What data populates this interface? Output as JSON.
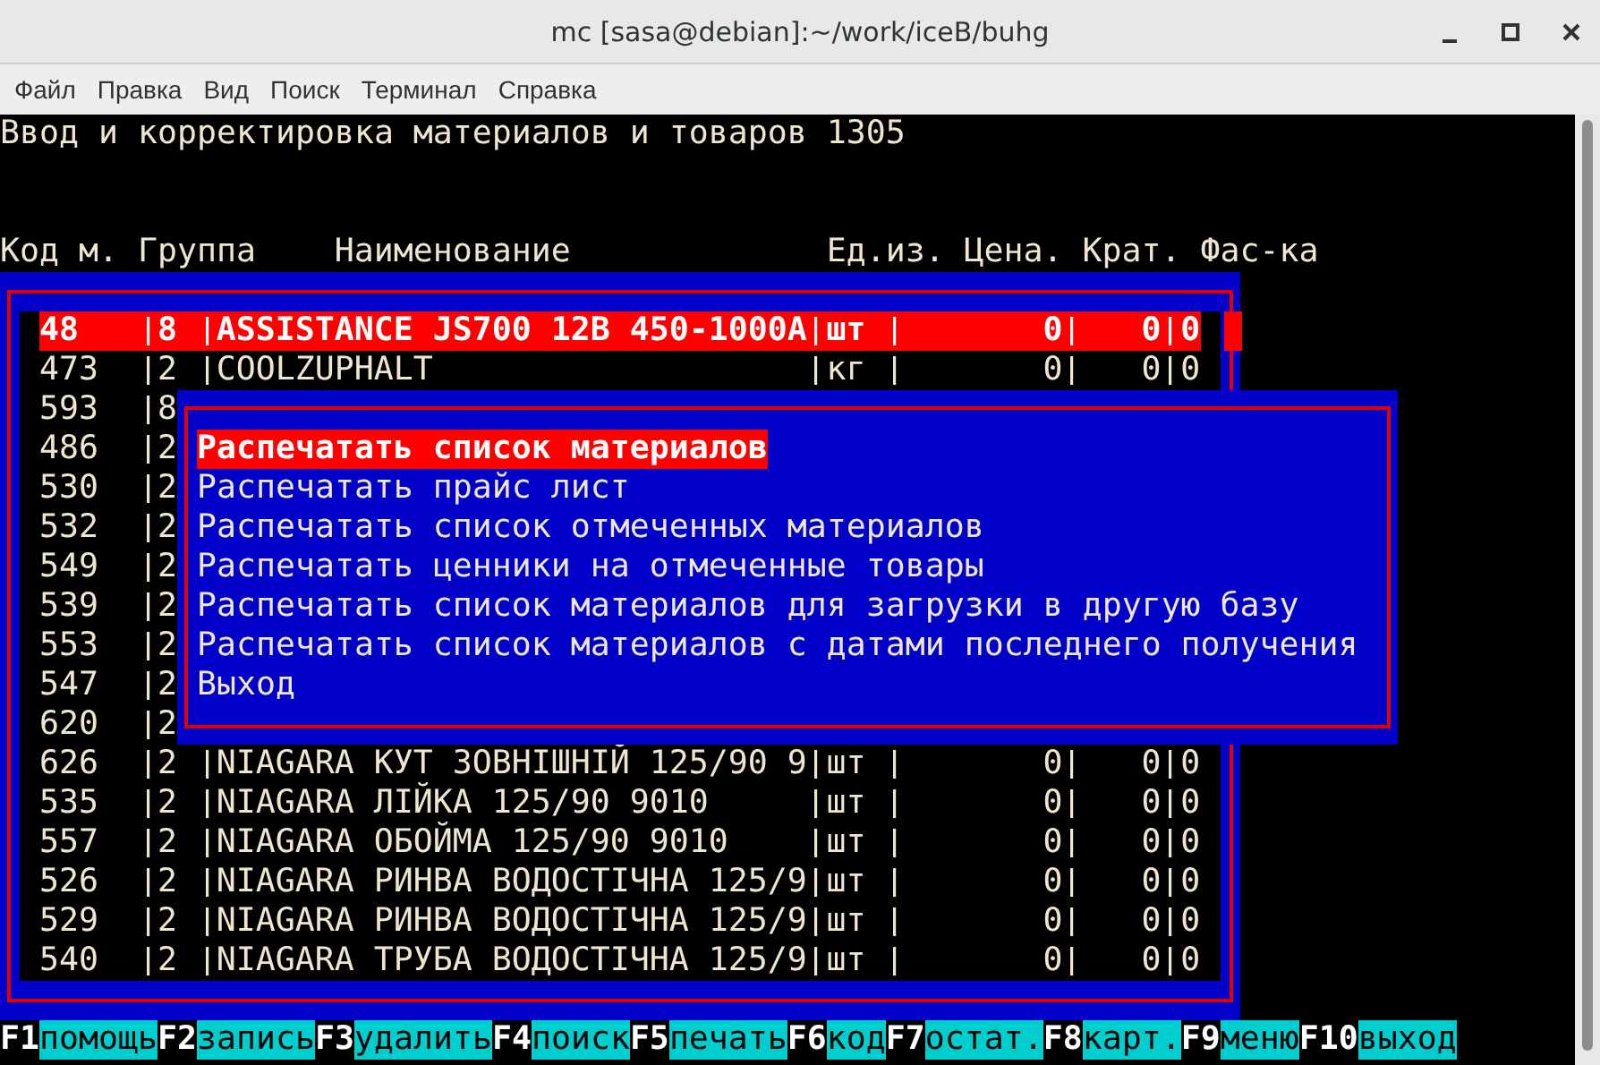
{
  "window": {
    "title": "mc [sasa@debian]:~/work/iceB/buhg"
  },
  "menu": [
    "Файл",
    "Правка",
    "Вид",
    "Поиск",
    "Терминал",
    "Справка"
  ],
  "screen_title": "Ввод и корректировка материалов и товаров 1305",
  "table": {
    "columns": [
      "Код м.",
      "Группа",
      "Наименование",
      "Ед.из.",
      "Цена.",
      "Крат.",
      "Фас-ка"
    ],
    "rows": [
      {
        "code": "48",
        "group": "8",
        "name": "ASSISTANCE JS700 12B 450-1000A",
        "unit": "шт",
        "price": "0",
        "multiplicity": "0",
        "packing": "0",
        "selected": true
      },
      {
        "code": "473",
        "group": "2",
        "name": "COOLZUPHALT",
        "unit": "кг",
        "price": "0",
        "multiplicity": "0",
        "packing": "0",
        "selected": false
      },
      {
        "code": "593",
        "group": "8",
        "selected": false
      },
      {
        "code": "486",
        "group": "2",
        "selected": false
      },
      {
        "code": "530",
        "group": "2",
        "selected": false
      },
      {
        "code": "532",
        "group": "2",
        "selected": false
      },
      {
        "code": "549",
        "group": "2",
        "selected": false
      },
      {
        "code": "539",
        "group": "2",
        "selected": false
      },
      {
        "code": "553",
        "group": "2",
        "selected": false
      },
      {
        "code": "547",
        "group": "2",
        "selected": false
      },
      {
        "code": "620",
        "group": "2",
        "selected": false
      },
      {
        "code": "626",
        "group": "2",
        "name": "NIAGARA КУТ ЗОВНІШНІЙ 125/90 9",
        "unit": "шт",
        "price": "0",
        "multiplicity": "0",
        "packing": "0",
        "selected": false
      },
      {
        "code": "535",
        "group": "2",
        "name": "NIAGARA ЛІЙКА 125/90 9010",
        "unit": "шт",
        "price": "0",
        "multiplicity": "0",
        "packing": "0",
        "selected": false
      },
      {
        "code": "557",
        "group": "2",
        "name": "NIAGARA ОБОЙМА 125/90 9010",
        "unit": "шт",
        "price": "0",
        "multiplicity": "0",
        "packing": "0",
        "selected": false
      },
      {
        "code": "526",
        "group": "2",
        "name": "NIAGARA РИНВА ВОДОСТІЧНА 125/9",
        "unit": "шт",
        "price": "0",
        "multiplicity": "0",
        "packing": "0",
        "selected": false
      },
      {
        "code": "529",
        "group": "2",
        "name": "NIAGARA РИНВА ВОДОСТІЧНА 125/9",
        "unit": "шт",
        "price": "0",
        "multiplicity": "0",
        "packing": "0",
        "selected": false
      },
      {
        "code": "540",
        "group": "2",
        "name": "NIAGARA ТРУБА ВОДОСТІЧНА 125/9",
        "unit": "шт",
        "price": "0",
        "multiplicity": "0",
        "packing": "0",
        "selected": false
      }
    ]
  },
  "popup": {
    "items": [
      {
        "label": "Распечатать список материалов",
        "selected": true
      },
      {
        "label": "Распечатать прайс лист",
        "selected": false
      },
      {
        "label": "Распечатать список отмеченных материалов",
        "selected": false
      },
      {
        "label": "Распечатать ценники на отмеченные товары",
        "selected": false
      },
      {
        "label": "Распечатать список материалов для загрузки в другую базу",
        "selected": false
      },
      {
        "label": "Распечатать список материалов с датами последнего получения",
        "selected": false
      },
      {
        "label": "Выход",
        "selected": false
      }
    ]
  },
  "function_keys": [
    {
      "key": "F1",
      "label": "помощь"
    },
    {
      "key": "F2",
      "label": "запись"
    },
    {
      "key": "F3",
      "label": "удалить"
    },
    {
      "key": "F4",
      "label": "поиск"
    },
    {
      "key": "F5",
      "label": "печать"
    },
    {
      "key": "F6",
      "label": "код"
    },
    {
      "key": "F7",
      "label": "остат."
    },
    {
      "key": "F8",
      "label": "карт."
    },
    {
      "key": "F9",
      "label": "меню"
    },
    {
      "key": "F10",
      "label": "выход"
    }
  ]
}
